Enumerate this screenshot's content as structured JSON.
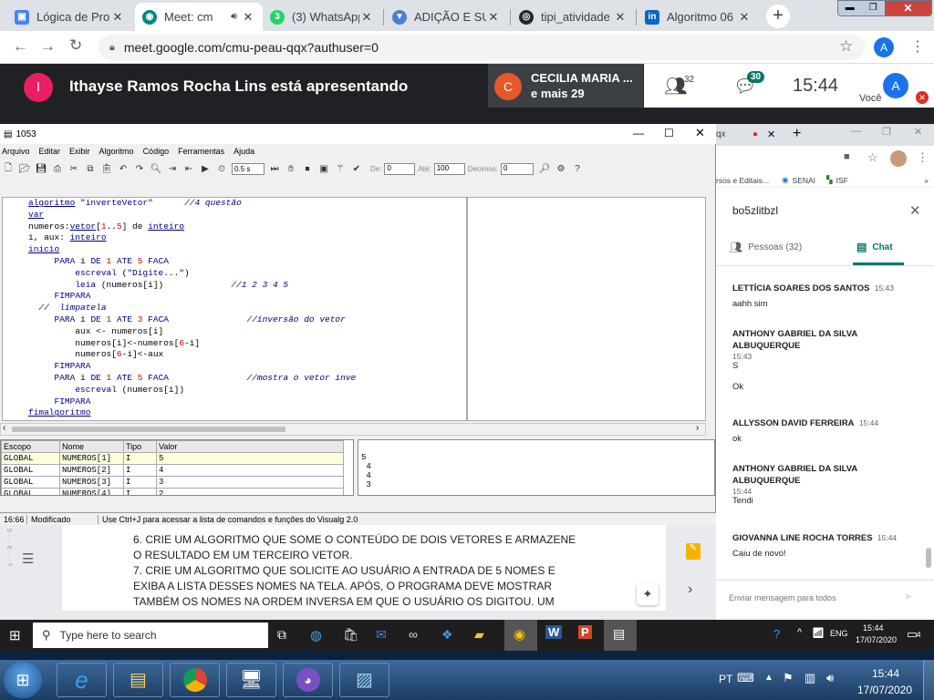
{
  "browser": {
    "tabs": [
      {
        "label": "Lógica de Pro",
        "icon": "google-classroom-icon"
      },
      {
        "label": "Meet: cm",
        "icon": "google-meet-icon"
      },
      {
        "label": "(3) WhatsApp",
        "icon": "whatsapp-icon"
      },
      {
        "label": "ADIÇÃO E SU",
        "icon": "download-icon"
      },
      {
        "label": "tipi_atividade",
        "icon": "github-icon"
      },
      {
        "label": "Algoritmo 06",
        "icon": "linkedin-icon"
      }
    ],
    "url": "meet.google.com/cmu-peau-qqx?authuser=0",
    "profile_initial": "A"
  },
  "meet": {
    "presenter_initial": "I",
    "presenting_text": "Ithayse Ramos Rocha Lins está apresentando",
    "other_initial": "C",
    "other_name": "CECILIA MARIA ...",
    "other_more": "e mais 29",
    "people_count": "32",
    "chat_count": "30",
    "clock": "15:44",
    "you_label": "Você",
    "you_initial": "A"
  },
  "visualg": {
    "title": "1053",
    "menu": [
      "Arquivo",
      "Editar",
      "Exibir",
      "Algoritmo",
      "Código",
      "Ferramentas",
      "Ajuda"
    ],
    "speed": "0.5 s",
    "de_label": "De:",
    "de_value": "0",
    "ate_label": "Até:",
    "ate_value": "100",
    "decimos_label": "Decimos:",
    "decimos_value": "0",
    "var_headers": [
      "Escopo",
      "Nome",
      "Tipo",
      "Valor"
    ],
    "var_rows": [
      [
        "GLOBAL",
        "NUMEROS[1]",
        "I",
        "5"
      ],
      [
        "GLOBAL",
        "NUMEROS[2]",
        "I",
        "4"
      ],
      [
        "GLOBAL",
        "NUMEROS[3]",
        "I",
        "3"
      ],
      [
        "GLOBAL",
        "NUMEROS[4]",
        "I",
        "2"
      ]
    ],
    "output_lines": [
      "5",
      " 4",
      " 4",
      " 3"
    ],
    "status_pos": "16:66",
    "status_mod": "Modificado",
    "status_hint": "Use Ctrl+J para acessar a lista de comandos e funções do Visualg 2.0"
  },
  "side_browser": {
    "tab_label": "qx",
    "bookmarks": [
      "rsos e Editais...",
      "SENAI",
      "ISF"
    ]
  },
  "chat": {
    "meeting_code": "bo5zlitbzl",
    "tab_people": "Pessoas (32)",
    "tab_chat": "Chat",
    "messages": [
      {
        "who": "LETTÍCIA SOARES DOS SANTOS",
        "time": "15:43",
        "lines": [
          "aahh sim"
        ]
      },
      {
        "who": "ANTHONY GABRIEL DA SILVA ALBUQUERQUE",
        "time": "15:43",
        "lines": [
          "S",
          "Ok"
        ]
      },
      {
        "who": "ALLYSSON DAVID FERREIRA",
        "time": "15:44",
        "lines": [
          "ok"
        ]
      },
      {
        "who": "ANTHONY GABRIEL DA SILVA ALBUQUERQUE",
        "time": "15:44",
        "lines": [
          "Tendi"
        ]
      },
      {
        "who": "GIOVANNA LINE ROCHA TORRES",
        "time": "15:44",
        "lines": [
          "Caiu de novo!"
        ]
      }
    ],
    "input_placeholder": "Enviar mensagem para todos"
  },
  "doc": {
    "lines": [
      "6. CRIE UM ALGORITMO QUE SOME O CONTEÚDO DE DOIS VETORES E ARMAZENE",
      "O RESULTADO EM UM TERCEIRO VETOR.",
      "7. CRIE UM ALGORITMO QUE SOLICITE AO USUÁRIO A ENTRADA DE 5 NOMES E",
      "EXIBA A LISTA DESSES NOMES NA TELA. APÓS, O PROGRAMA DEVE MOSTRAR",
      "TAMBÉM OS NOMES NA ORDEM INVERSA EM QUE O USUÁRIO OS DIGITOU. UM"
    ]
  },
  "win10": {
    "search_placeholder": "Type here to search",
    "lang": "ENG",
    "time": "15:44",
    "date": "17/07/2020",
    "notif_count": "4"
  },
  "win7": {
    "lang": "PT",
    "time": "15:44",
    "date": "17/07/2020"
  },
  "colors": {
    "meet_bg": "#202124",
    "chat_accent": "#00796b",
    "code_keyword": "#00008b",
    "code_number": "#cc0000"
  }
}
